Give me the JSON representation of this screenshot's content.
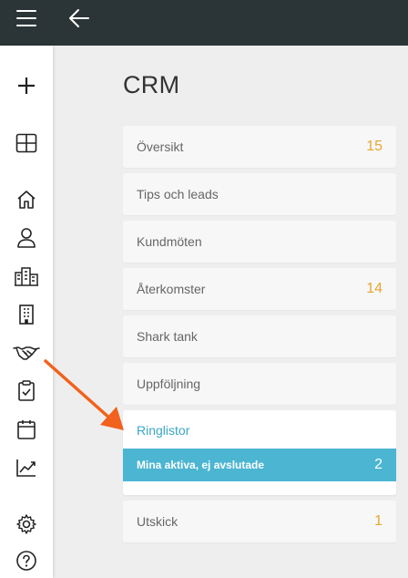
{
  "page_title": "CRM",
  "accent_color": "#4bb5d2",
  "count_color": "#e6a731",
  "topbar": {
    "menu_icon": "hamburger-icon",
    "back_icon": "arrow-left-icon"
  },
  "sidebar": {
    "icons": [
      "plus-icon",
      "grid-icon",
      "home-icon",
      "user-icon",
      "buildings-icon",
      "building-icon",
      "handshake-icon",
      "clipboard-check-icon",
      "calendar-icon",
      "chart-line-icon",
      "gear-icon",
      "help-icon"
    ]
  },
  "menu": {
    "oversikt": {
      "label": "Översikt",
      "count": "15"
    },
    "tips": {
      "label": "Tips och leads"
    },
    "kundmoten": {
      "label": "Kundmöten"
    },
    "aterkomster": {
      "label": "Återkomster",
      "count": "14"
    },
    "shark": {
      "label": "Shark tank"
    },
    "uppfoljning": {
      "label": "Uppföljning"
    },
    "ringlistor": {
      "label": "Ringlistor",
      "sub": {
        "label": "Mina aktiva, ej avslutade",
        "count": "2"
      }
    },
    "utskick": {
      "label": "Utskick",
      "count": "1"
    }
  }
}
